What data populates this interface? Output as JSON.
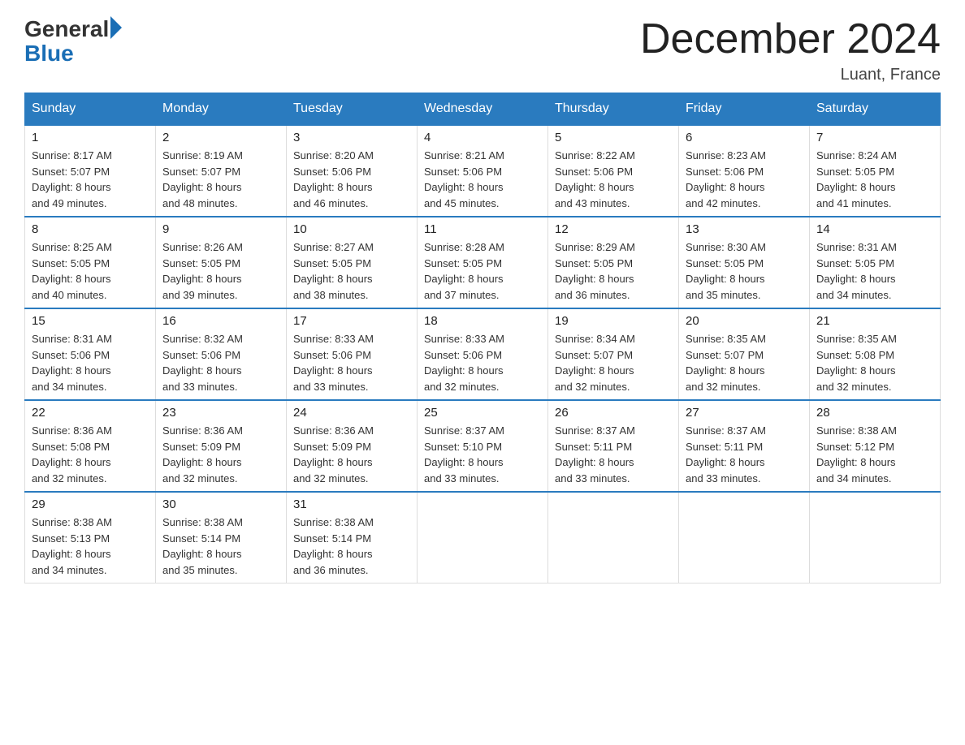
{
  "logo": {
    "general": "General",
    "blue": "Blue"
  },
  "title": "December 2024",
  "subtitle": "Luant, France",
  "days_of_week": [
    "Sunday",
    "Monday",
    "Tuesday",
    "Wednesday",
    "Thursday",
    "Friday",
    "Saturday"
  ],
  "weeks": [
    [
      {
        "day": "1",
        "sunrise": "8:17 AM",
        "sunset": "5:07 PM",
        "daylight": "8 hours and 49 minutes."
      },
      {
        "day": "2",
        "sunrise": "8:19 AM",
        "sunset": "5:07 PM",
        "daylight": "8 hours and 48 minutes."
      },
      {
        "day": "3",
        "sunrise": "8:20 AM",
        "sunset": "5:06 PM",
        "daylight": "8 hours and 46 minutes."
      },
      {
        "day": "4",
        "sunrise": "8:21 AM",
        "sunset": "5:06 PM",
        "daylight": "8 hours and 45 minutes."
      },
      {
        "day": "5",
        "sunrise": "8:22 AM",
        "sunset": "5:06 PM",
        "daylight": "8 hours and 43 minutes."
      },
      {
        "day": "6",
        "sunrise": "8:23 AM",
        "sunset": "5:06 PM",
        "daylight": "8 hours and 42 minutes."
      },
      {
        "day": "7",
        "sunrise": "8:24 AM",
        "sunset": "5:05 PM",
        "daylight": "8 hours and 41 minutes."
      }
    ],
    [
      {
        "day": "8",
        "sunrise": "8:25 AM",
        "sunset": "5:05 PM",
        "daylight": "8 hours and 40 minutes."
      },
      {
        "day": "9",
        "sunrise": "8:26 AM",
        "sunset": "5:05 PM",
        "daylight": "8 hours and 39 minutes."
      },
      {
        "day": "10",
        "sunrise": "8:27 AM",
        "sunset": "5:05 PM",
        "daylight": "8 hours and 38 minutes."
      },
      {
        "day": "11",
        "sunrise": "8:28 AM",
        "sunset": "5:05 PM",
        "daylight": "8 hours and 37 minutes."
      },
      {
        "day": "12",
        "sunrise": "8:29 AM",
        "sunset": "5:05 PM",
        "daylight": "8 hours and 36 minutes."
      },
      {
        "day": "13",
        "sunrise": "8:30 AM",
        "sunset": "5:05 PM",
        "daylight": "8 hours and 35 minutes."
      },
      {
        "day": "14",
        "sunrise": "8:31 AM",
        "sunset": "5:05 PM",
        "daylight": "8 hours and 34 minutes."
      }
    ],
    [
      {
        "day": "15",
        "sunrise": "8:31 AM",
        "sunset": "5:06 PM",
        "daylight": "8 hours and 34 minutes."
      },
      {
        "day": "16",
        "sunrise": "8:32 AM",
        "sunset": "5:06 PM",
        "daylight": "8 hours and 33 minutes."
      },
      {
        "day": "17",
        "sunrise": "8:33 AM",
        "sunset": "5:06 PM",
        "daylight": "8 hours and 33 minutes."
      },
      {
        "day": "18",
        "sunrise": "8:33 AM",
        "sunset": "5:06 PM",
        "daylight": "8 hours and 32 minutes."
      },
      {
        "day": "19",
        "sunrise": "8:34 AM",
        "sunset": "5:07 PM",
        "daylight": "8 hours and 32 minutes."
      },
      {
        "day": "20",
        "sunrise": "8:35 AM",
        "sunset": "5:07 PM",
        "daylight": "8 hours and 32 minutes."
      },
      {
        "day": "21",
        "sunrise": "8:35 AM",
        "sunset": "5:08 PM",
        "daylight": "8 hours and 32 minutes."
      }
    ],
    [
      {
        "day": "22",
        "sunrise": "8:36 AM",
        "sunset": "5:08 PM",
        "daylight": "8 hours and 32 minutes."
      },
      {
        "day": "23",
        "sunrise": "8:36 AM",
        "sunset": "5:09 PM",
        "daylight": "8 hours and 32 minutes."
      },
      {
        "day": "24",
        "sunrise": "8:36 AM",
        "sunset": "5:09 PM",
        "daylight": "8 hours and 32 minutes."
      },
      {
        "day": "25",
        "sunrise": "8:37 AM",
        "sunset": "5:10 PM",
        "daylight": "8 hours and 33 minutes."
      },
      {
        "day": "26",
        "sunrise": "8:37 AM",
        "sunset": "5:11 PM",
        "daylight": "8 hours and 33 minutes."
      },
      {
        "day": "27",
        "sunrise": "8:37 AM",
        "sunset": "5:11 PM",
        "daylight": "8 hours and 33 minutes."
      },
      {
        "day": "28",
        "sunrise": "8:38 AM",
        "sunset": "5:12 PM",
        "daylight": "8 hours and 34 minutes."
      }
    ],
    [
      {
        "day": "29",
        "sunrise": "8:38 AM",
        "sunset": "5:13 PM",
        "daylight": "8 hours and 34 minutes."
      },
      {
        "day": "30",
        "sunrise": "8:38 AM",
        "sunset": "5:14 PM",
        "daylight": "8 hours and 35 minutes."
      },
      {
        "day": "31",
        "sunrise": "8:38 AM",
        "sunset": "5:14 PM",
        "daylight": "8 hours and 36 minutes."
      },
      null,
      null,
      null,
      null
    ]
  ]
}
